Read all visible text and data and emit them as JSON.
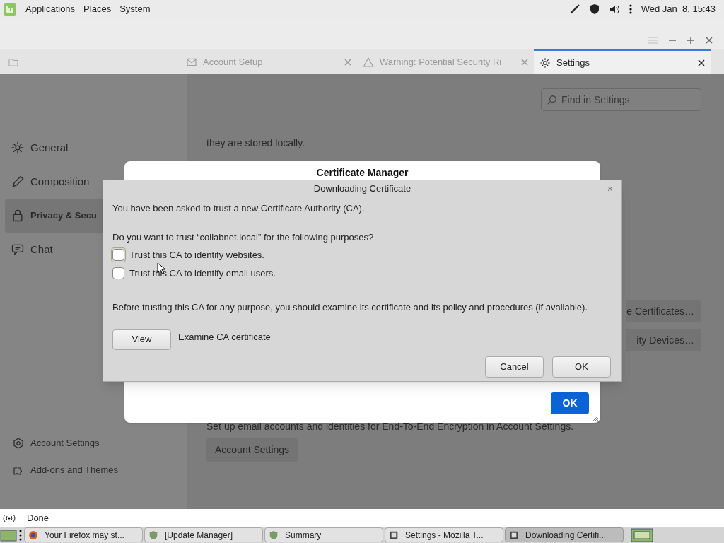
{
  "top_panel": {
    "menus": [
      "Applications",
      "Places",
      "System"
    ],
    "clock": "Wed Jan  8, 15:43"
  },
  "tabs": [
    {
      "label": "Account Setup",
      "kind": "mail",
      "selected": false
    },
    {
      "label": "Warning: Potential Security Ri",
      "kind": "warning",
      "selected": false
    },
    {
      "label": "Settings",
      "kind": "gear",
      "selected": true
    }
  ],
  "sidebar": {
    "items": [
      {
        "label": "General",
        "kind": "gear",
        "selected": false
      },
      {
        "label": "Composition",
        "kind": "pencil",
        "selected": false
      },
      {
        "label": "Privacy & Secu",
        "kind": "lock",
        "selected": true
      },
      {
        "label": "Chat",
        "kind": "chat",
        "selected": false
      }
    ],
    "footer_items": [
      {
        "label": "Account Settings",
        "kind": "account"
      },
      {
        "label": "Add-ons and Themes",
        "kind": "puzzle"
      }
    ]
  },
  "content": {
    "search": {
      "placeholder": "Find in Settings"
    },
    "intro_tail": "they are stored locally.",
    "side_buttons": [
      "e Certificates…",
      "ity Devices…"
    ],
    "e2e_text": "Set up email accounts and identities for End-To-End Encryption in Account Settings.",
    "e2e_button": "Account Settings"
  },
  "certificate_manager": {
    "title": "Certificate Manager",
    "ok": "OK"
  },
  "download_dialog": {
    "title": "Downloading Certificate",
    "close": "×",
    "intro": "You have been asked to trust a new Certificate Authority (CA).",
    "question": "Do you want to trust “collabnet.local” for the following purposes?",
    "options": [
      {
        "label": "Trust this CA to identify websites.",
        "checked": false,
        "focused": true
      },
      {
        "label": "Trust this CA to identify email users.",
        "checked": false,
        "focused": false
      }
    ],
    "advice": "Before trusting this CA for any purpose, you should examine its certificate and its policy and procedures (if available).",
    "view_button": "View",
    "view_label": "Examine CA certificate",
    "buttons": [
      "Cancel",
      "OK"
    ]
  },
  "status_bar": {
    "text": "Done"
  },
  "taskbar": {
    "items": [
      {
        "label": "Your Firefox may st...",
        "kind": "firefox",
        "selected": false
      },
      {
        "label": "[Update Manager]",
        "kind": "shield",
        "selected": false
      },
      {
        "label": "Summary",
        "kind": "shield",
        "selected": false
      },
      {
        "label": "Settings - Mozilla T...",
        "kind": "app",
        "selected": false
      },
      {
        "label": "Downloading Certifi...",
        "kind": "app",
        "selected": true
      }
    ]
  }
}
